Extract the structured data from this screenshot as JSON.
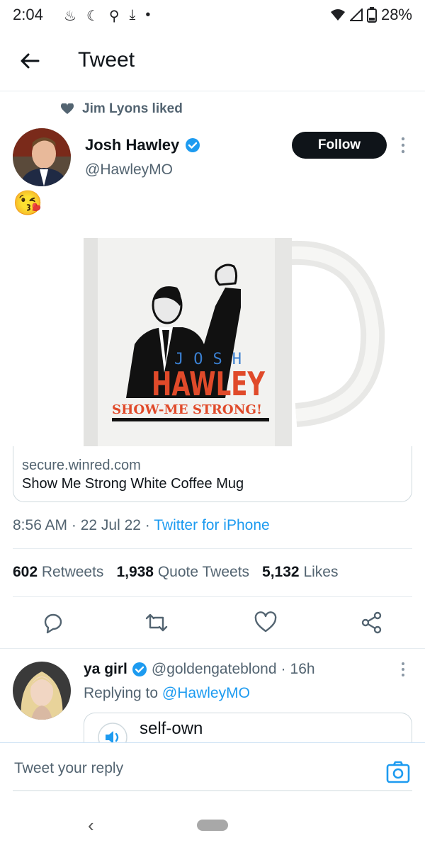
{
  "status_bar": {
    "time": "2:04",
    "battery": "28%"
  },
  "header": {
    "title": "Tweet"
  },
  "social_context": {
    "text": "Jim Lyons liked"
  },
  "tweet": {
    "author_name": "Josh Hawley",
    "author_handle": "@HawleyMO",
    "follow_label": "Follow",
    "body_emoji": "😘",
    "media_text": {
      "first": "JOSH",
      "last": "HAWLEY",
      "slogan": "SHOW-ME STRONG!"
    },
    "card": {
      "domain": "secure.winred.com",
      "title": "Show Me Strong White Coffee Mug"
    },
    "time": "8:56 AM",
    "date": "22 Jul 22",
    "source": "Twitter for iPhone",
    "retweets_count": "602",
    "retweets_label": "Retweets",
    "quotes_count": "1,938",
    "quotes_label": "Quote Tweets",
    "likes_count": "5,132",
    "likes_label": "Likes"
  },
  "reply": {
    "name": "ya girl",
    "handle": "@goldengateblond",
    "age": "16h",
    "replying_prefix": "Replying to",
    "replying_to": "@HawleyMO",
    "card_text": "self-own"
  },
  "compose": {
    "placeholder": "Tweet your reply"
  },
  "colors": {
    "accent": "#1d9bf0",
    "verified": "#1d9bf0",
    "text": "#0f1419",
    "secondary": "#536471"
  }
}
